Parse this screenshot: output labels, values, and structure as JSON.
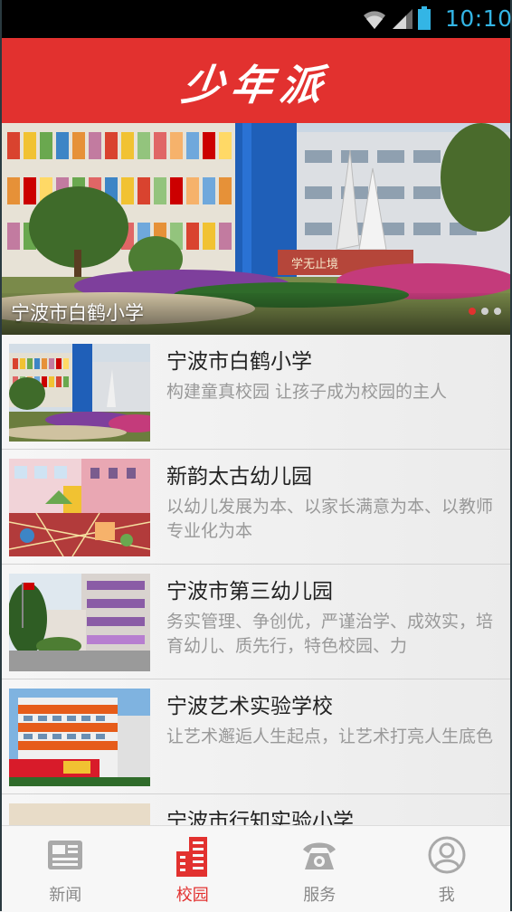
{
  "status_bar": {
    "time": "10:10",
    "accent_color": "#33b5e5"
  },
  "app": {
    "title": "少年派",
    "brand_color": "#e2312f"
  },
  "banner": {
    "caption": "宁波市白鹤小学",
    "dot_count": 3,
    "active_dot": 0,
    "sign_text": "学无止境"
  },
  "schools": [
    {
      "name": "宁波市白鹤小学",
      "description": "构建童真校园 让孩子成为校园的主人",
      "thumb_icon": "school-building-photo"
    },
    {
      "name": "新韵太古幼儿园",
      "description": "以幼儿发展为本、以家长满意为本、以教师专业化为本",
      "thumb_icon": "kindergarten-playground-photo"
    },
    {
      "name": "宁波市第三幼儿园",
      "description": "务实管理、争创优，严谨治学、成效实，培育幼儿、质先行，特色校园、力",
      "thumb_icon": "kindergarten-building-photo"
    },
    {
      "name": "宁波艺术实验学校",
      "description": "让艺术邂逅人生起点，让艺术打亮人生底色",
      "thumb_icon": "art-school-building-photo"
    },
    {
      "name": "宁波市行知实验小学",
      "description": "",
      "thumb_icon": "school-building-photo"
    }
  ],
  "bottom_nav": {
    "items": [
      {
        "label": "新闻",
        "icon": "newspaper-icon",
        "active": false
      },
      {
        "label": "校园",
        "icon": "campus-building-icon",
        "active": true
      },
      {
        "label": "服务",
        "icon": "telephone-icon",
        "active": false
      },
      {
        "label": "我",
        "icon": "user-icon",
        "active": false
      }
    ],
    "active_color": "#e2312f",
    "inactive_color": "#888888"
  }
}
